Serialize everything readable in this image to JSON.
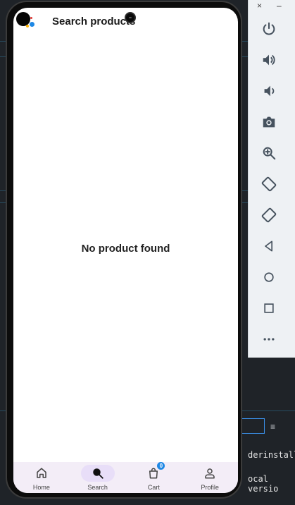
{
  "app": {
    "title": "Search products",
    "empty_message": "No product found"
  },
  "bottom_nav": {
    "items": [
      {
        "label": "Home",
        "icon": "home-icon",
        "active": false
      },
      {
        "label": "Search",
        "icon": "search-icon",
        "active": true
      },
      {
        "label": "Cart",
        "icon": "cart-icon",
        "active": false,
        "badge": "0"
      },
      {
        "label": "Profile",
        "icon": "profile-icon",
        "active": false
      }
    ]
  },
  "emulator_panel": {
    "close": "×",
    "minimize": "–",
    "controls": [
      "power-icon",
      "volume-up-icon",
      "volume-down-icon",
      "camera-icon",
      "zoom-icon",
      "rotate-left-icon",
      "rotate-right-icon",
      "back-icon",
      "home-circle-icon",
      "overview-icon",
      "more-icon"
    ]
  },
  "ide": {
    "line1": "derinstalle",
    "line2": "ocal versio"
  },
  "colors": {
    "accent": "#1e88e5",
    "nav_background": "#f3edf7",
    "nav_active_pill": "#e8def8"
  }
}
